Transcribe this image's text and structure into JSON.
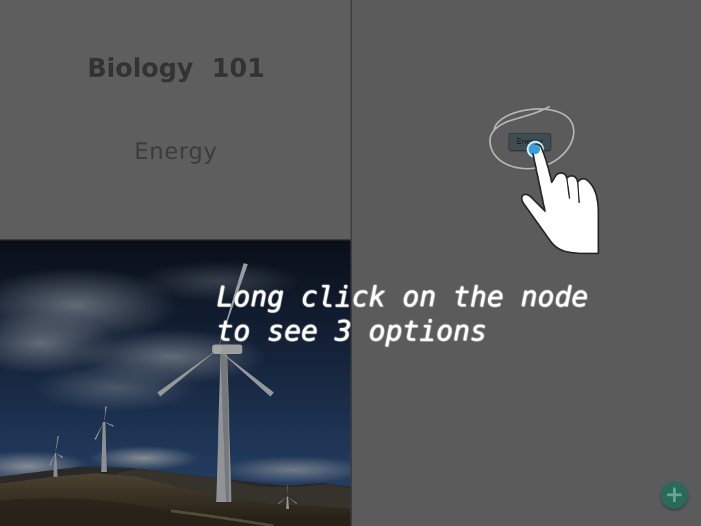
{
  "lesson_card": {
    "course_title": "Biology  101",
    "topic_title": "Energy"
  },
  "image": {
    "subject_icon": "wind-turbine-photo"
  },
  "mindmap": {
    "node_label": "Energy"
  },
  "tutorial": {
    "line1": "Long click on the node",
    "line2": "to see 3 options",
    "gesture_icon": "tap-hand-icon"
  },
  "fab": {
    "icon": "plus-icon",
    "glyph": "+",
    "color": "#2b6a5a"
  }
}
